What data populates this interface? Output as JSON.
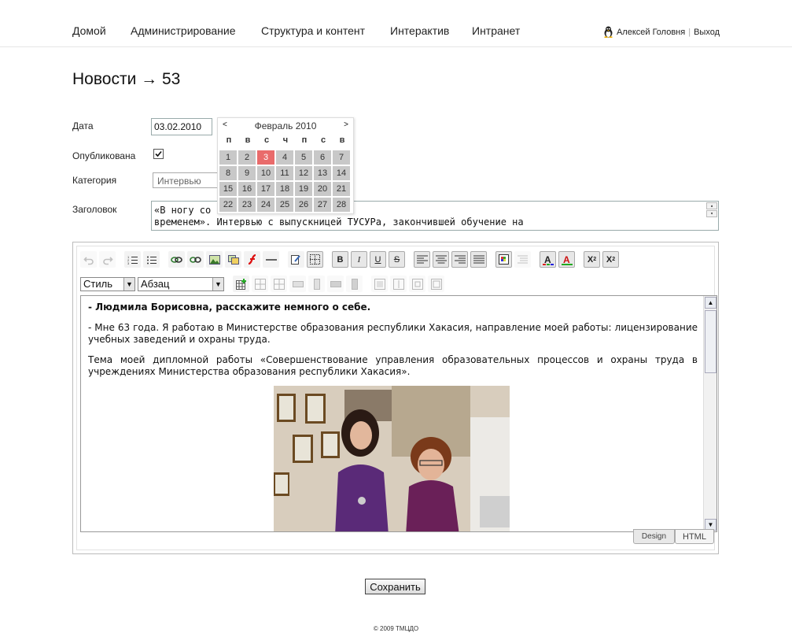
{
  "nav": {
    "items": [
      "Домой",
      "Администрирование",
      "Структура и контент",
      "Интерактив",
      "Интранет"
    ],
    "user_name": "Алексей Головня",
    "separator": "|",
    "logout": "Выход"
  },
  "page_title": "Новости → 53",
  "form": {
    "date_label": "Дата",
    "date_value": "03.02.2010",
    "published_label": "Опубликована",
    "published_checked": true,
    "category_label": "Категория",
    "category_value": "Интервью",
    "title_label": "Заголовок",
    "title_line1": "«В ногу со",
    "title_line2": "временем». Интервью с выпускницей ТУСУРа, закончившей обучение на"
  },
  "calendar": {
    "prev": "<",
    "next": ">",
    "month": "Февраль 2010",
    "dow": [
      "п",
      "в",
      "с",
      "ч",
      "п",
      "с",
      "в"
    ],
    "days": [
      "1",
      "2",
      "3",
      "4",
      "5",
      "6",
      "7",
      "8",
      "9",
      "10",
      "11",
      "12",
      "13",
      "14",
      "15",
      "16",
      "17",
      "18",
      "19",
      "20",
      "21",
      "22",
      "23",
      "24",
      "25",
      "26",
      "27",
      "28"
    ],
    "selected": "3",
    "selected_color": "#e96b6b"
  },
  "editor": {
    "style_select": "Стиль",
    "format_select": "Абзац",
    "toolbar1": [
      "undo-icon",
      "redo-icon",
      "ordered-list-icon",
      "unordered-list-icon",
      "link-icon",
      "unlink-icon",
      "image-icon",
      "image-manager-icon",
      "flash-icon",
      "horizontal-rule-icon",
      "edit-source-icon",
      "table-border-icon",
      "bold-icon",
      "italic-icon",
      "underline-icon",
      "strike-icon",
      "align-left-icon",
      "align-center-icon",
      "align-right-icon",
      "align-justify-icon",
      "paste-word-icon",
      "clean-icon",
      "font-color-icon",
      "highlight-icon",
      "superscript-icon",
      "subscript-icon"
    ],
    "paragraphs": [
      "- Людмила Борисовна, расскажите немного о себе.",
      "- Мне 63 года. Я работаю в Министерстве образования республики Хакасия, направление моей работы: лицензирование учебных заведений и охраны труда.",
      "Тема моей дипломной работы «Совершенствование управления образовательных процессов и охраны труда в учреждениях Министерства образования республики Хакасия»."
    ],
    "mode_design": "Design",
    "mode_html": "HTML"
  },
  "save_label": "Сохранить",
  "footer": "© 2009 ТМЦДО"
}
